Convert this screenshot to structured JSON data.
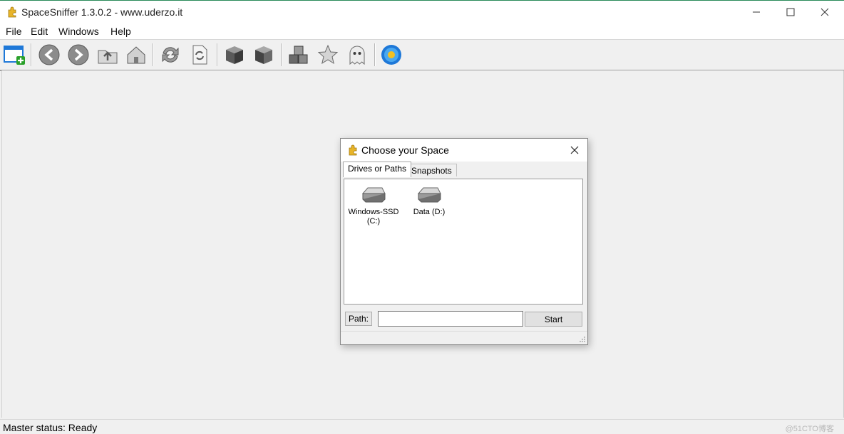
{
  "window": {
    "title": "SpaceSniffer 1.3.0.2 - www.uderzo.it"
  },
  "menu": [
    "File",
    "Edit",
    "Windows",
    "Help"
  ],
  "toolbar": {
    "icons": [
      "new-window-icon",
      "back-icon",
      "forward-icon",
      "up-folder-icon",
      "home-icon",
      "refresh-icon",
      "refresh-page-icon",
      "cube-icon",
      "cube-alt-icon",
      "cubes-icon",
      "star-icon",
      "ghost-icon",
      "flower-icon"
    ]
  },
  "dialog": {
    "title": "Choose your Space",
    "tabs": [
      "Drives or Paths",
      "Snapshots"
    ],
    "drives": [
      {
        "label": "Windows-SSD (C:)"
      },
      {
        "label": "Data (D:)"
      }
    ],
    "path_label": "Path:",
    "path_value": "",
    "start_label": "Start"
  },
  "status": {
    "text": "Master status: Ready"
  },
  "watermark": "@51CTO博客",
  "colors": {
    "accent": "#1e78d8",
    "puzzle": "#e8b428",
    "star": "#c8c8c8"
  }
}
